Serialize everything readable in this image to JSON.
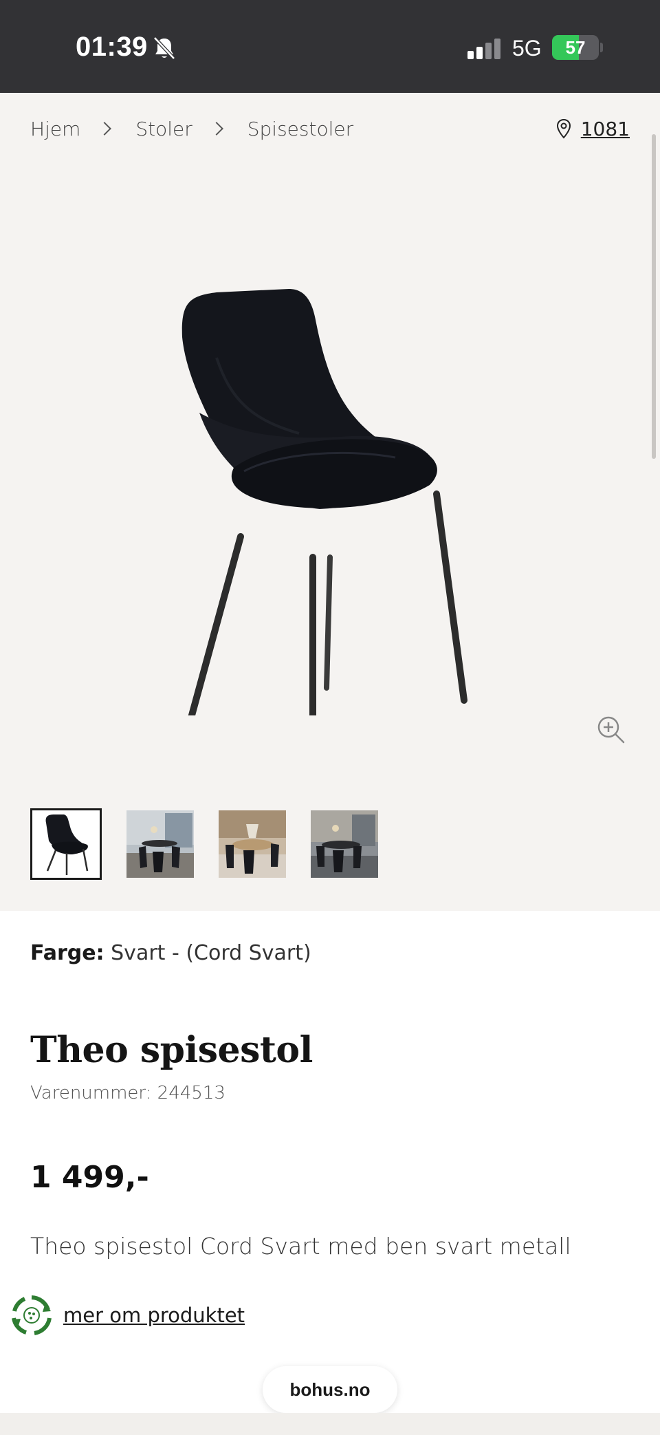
{
  "status": {
    "time": "01:39",
    "network": "5G",
    "battery_level": "57",
    "battery_fraction": 0.57
  },
  "breadcrumb": {
    "items": [
      "Hjem",
      "Stoler",
      "Spisestoler"
    ]
  },
  "store": {
    "code": "1081"
  },
  "gallery": {
    "thumbnails": [
      "chair-studio-photo",
      "dining-room-photo-1",
      "dining-room-photo-2",
      "dining-room-photo-3"
    ],
    "active_index": 0
  },
  "product": {
    "color_label": "Farge:",
    "color_value": "Svart - (Cord Svart)",
    "title": "Theo spisestol",
    "sku_text": "Varenummer: 244513",
    "price": "1 499,-",
    "description": "Theo spisestol Cord Svart med ben svart metall",
    "more_link": "mer om produktet"
  },
  "browser": {
    "url": "bohus.no"
  },
  "colors": {
    "status_bar": "#323235",
    "gallery_bg": "#f5f3f1",
    "battery_green": "#34c759",
    "recycle_green": "#2e7d32"
  }
}
